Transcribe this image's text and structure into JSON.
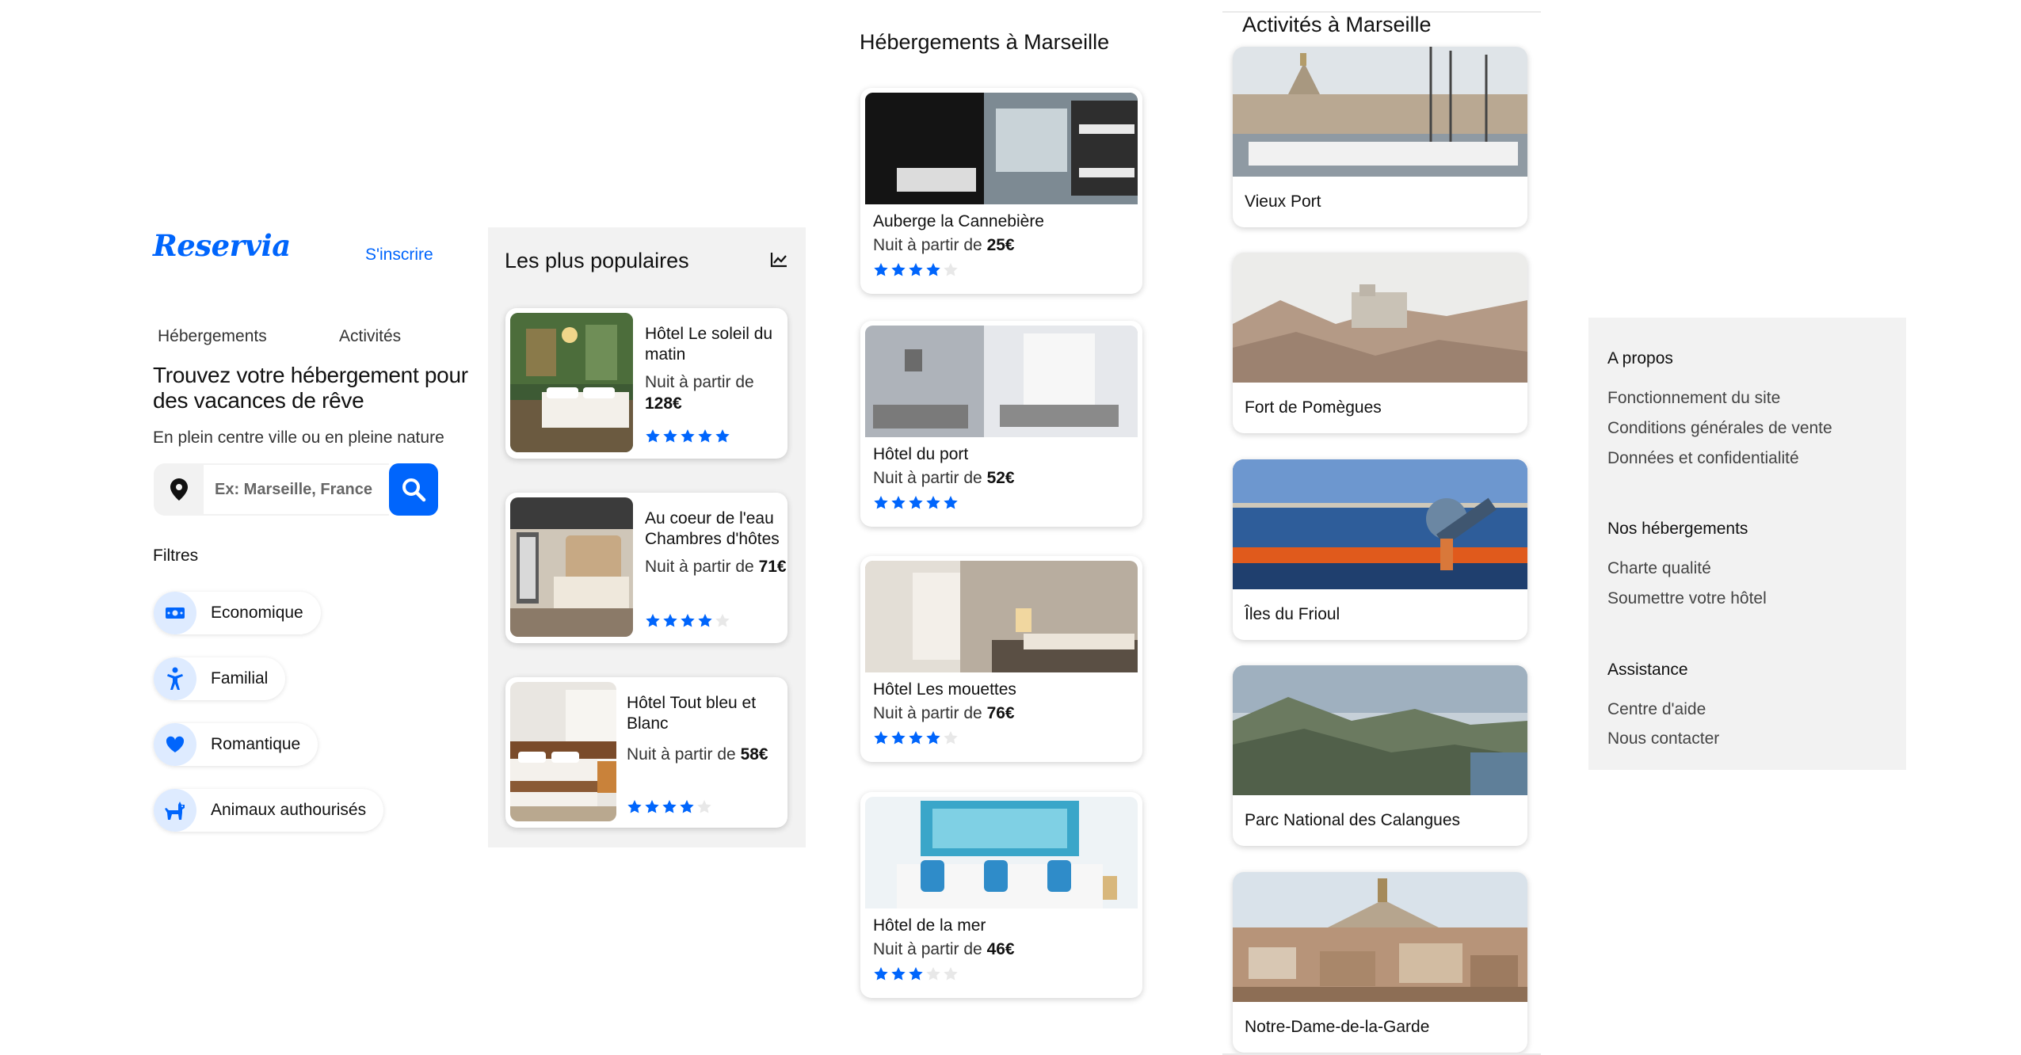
{
  "header": {
    "logo": "Reservia",
    "signup_label": "S'inscrire",
    "tabs": [
      {
        "label": "Hébergements"
      },
      {
        "label": "Activités"
      }
    ]
  },
  "hero": {
    "title": "Trouvez votre hébergement pour des vacances de rêve",
    "subtitle": "En plein centre ville ou en pleine nature"
  },
  "search": {
    "placeholder": "Ex: Marseille, France"
  },
  "filters": {
    "title": "Filtres",
    "items": [
      {
        "label": "Economique",
        "icon": "money-icon"
      },
      {
        "label": "Familial",
        "icon": "child-icon"
      },
      {
        "label": "Romantique",
        "icon": "heart-icon"
      },
      {
        "label": "Animaux authourisés",
        "icon": "dog-icon"
      }
    ]
  },
  "popular": {
    "title": "Les plus populaires",
    "icon": "trend-chart-icon",
    "items": [
      {
        "name": "Hôtel Le soleil du matin",
        "price_prefix": "Nuit à partir de",
        "price": "128€",
        "rating": 5
      },
      {
        "name": "Au coeur de l'eau Chambres d'hôtes",
        "price_prefix": "Nuit à partir de",
        "price": "71€",
        "rating": 4
      },
      {
        "name": "Hôtel Tout bleu et Blanc",
        "price_prefix": "Nuit à partir de",
        "price": "58€",
        "rating": 4
      }
    ]
  },
  "lodging": {
    "title": "Hébergements à Marseille",
    "items": [
      {
        "name": "Auberge la Cannebière",
        "price_prefix": "Nuit à partir de",
        "price": "25€",
        "rating": 4
      },
      {
        "name": "Hôtel du port",
        "price_prefix": "Nuit à partir de",
        "price": "52€",
        "rating": 5
      },
      {
        "name": "Hôtel Les mouettes",
        "price_prefix": "Nuit à partir de",
        "price": "76€",
        "rating": 4
      },
      {
        "name": "Hôtel de la mer",
        "price_prefix": "Nuit à partir de",
        "price": "46€",
        "rating": 3
      }
    ]
  },
  "activities": {
    "title": "Activités à Marseille",
    "items": [
      {
        "name": "Vieux Port"
      },
      {
        "name": "Fort de Pomègues"
      },
      {
        "name": "Îles du Frioul"
      },
      {
        "name": "Parc National des Calangues"
      },
      {
        "name": "Notre-Dame-de-la-Garde"
      }
    ]
  },
  "footer": {
    "sections": [
      {
        "title": "A propos",
        "links": [
          "Fonctionnement du site",
          "Conditions générales de vente",
          "Données et confidentialité"
        ]
      },
      {
        "title": "Nos hébergements",
        "links": [
          "Charte qualité",
          "Soumettre votre hôtel"
        ]
      },
      {
        "title": "Assistance",
        "links": [
          "Centre d'aide",
          "Nous contacter"
        ]
      }
    ]
  },
  "colors": {
    "accent": "#0065fc",
    "accent_light": "#deebff",
    "panel": "#f2f2f2",
    "star_empty": "#e8e8e8"
  }
}
